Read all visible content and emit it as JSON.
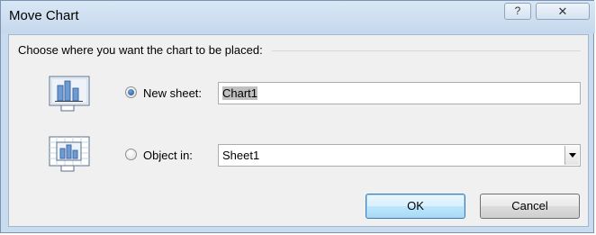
{
  "window": {
    "title": "Move Chart",
    "help_label": "?",
    "close_label": "✕"
  },
  "group": {
    "label": "Choose where you want the chart to be placed:"
  },
  "options": [
    {
      "label": "New sheet:",
      "value": "Chart1",
      "selected": true,
      "icon": "chart-sheet-icon"
    },
    {
      "label": "Object in:",
      "value": "Sheet1",
      "selected": false,
      "icon": "embedded-chart-icon"
    }
  ],
  "buttons": {
    "ok": "OK",
    "cancel": "Cancel"
  }
}
